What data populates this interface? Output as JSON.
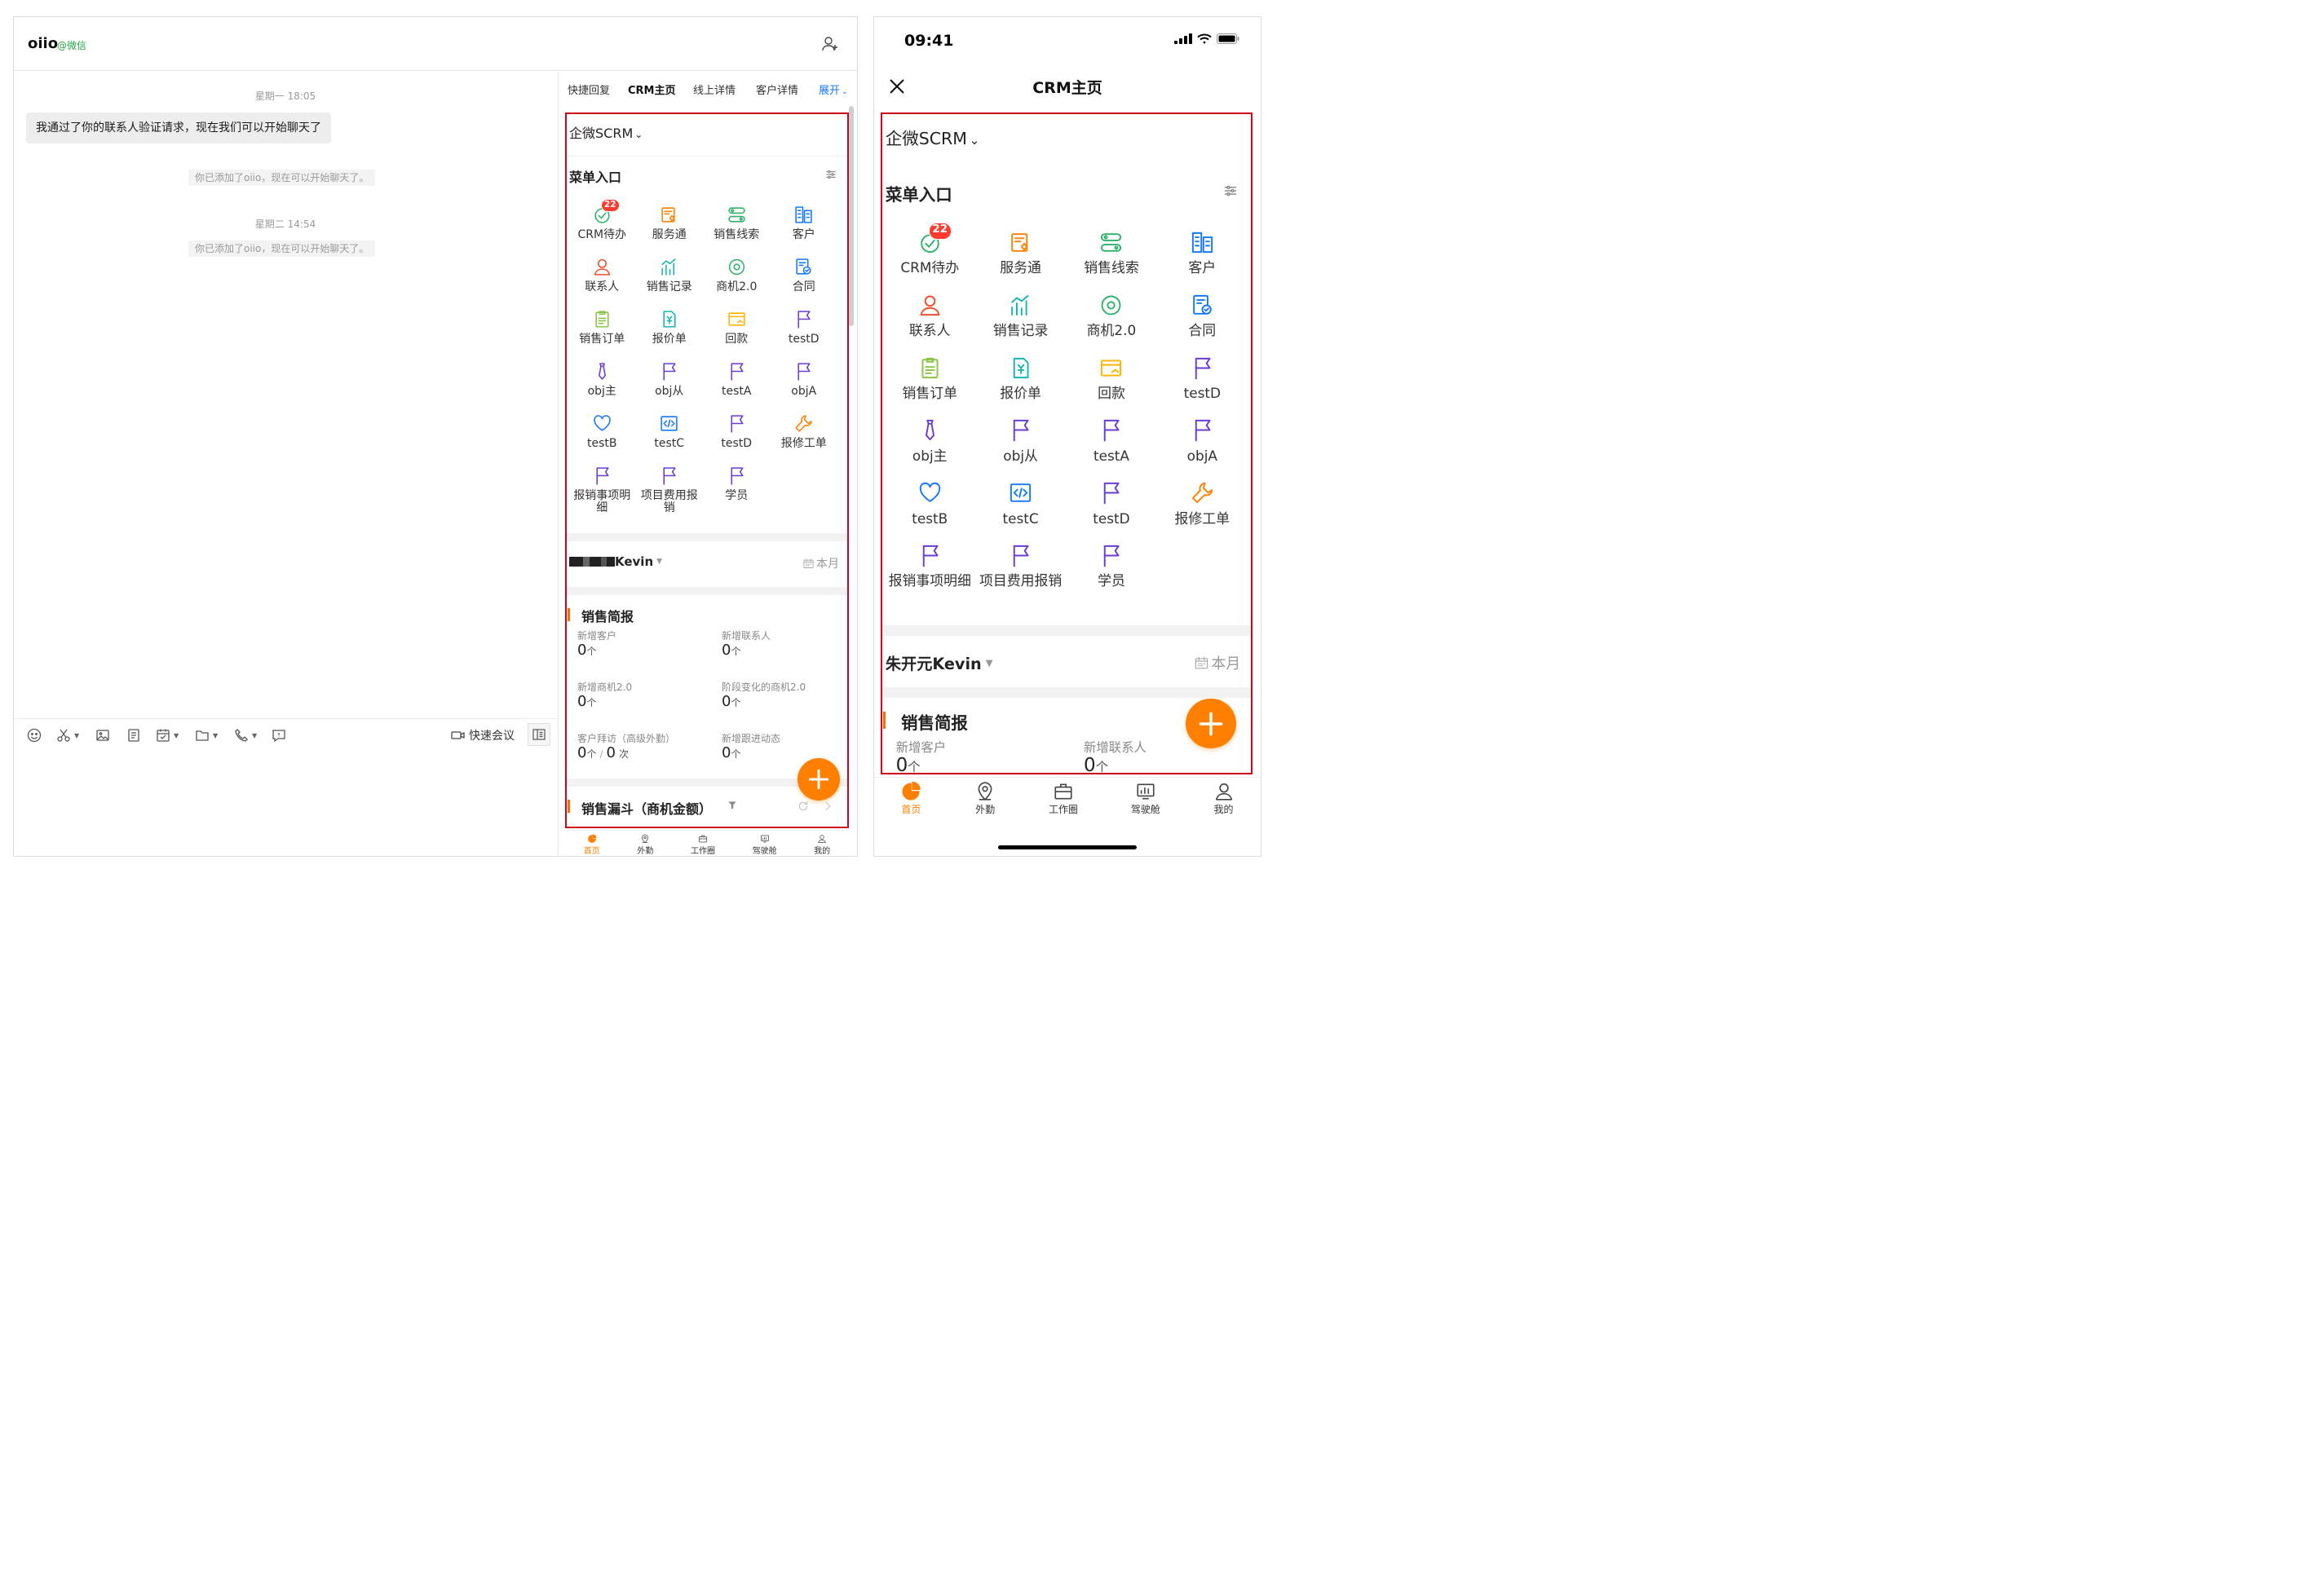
{
  "desktop": {
    "contact_name": "oiio",
    "contact_tag": "@微信",
    "chat": {
      "time_1": "星期一 18:05",
      "message": "我通过了你的联系人验证请求，现在我们可以开始聊天了",
      "system_note_1": "你已添加了oiio，现在可以开始聊天了。",
      "time_2": "星期二 14:54",
      "system_note_2": "你已添加了oiio，现在可以开始聊天了。"
    },
    "toolbar": {
      "quick_meeting": "快速会议",
      "icons": [
        "emoji-icon",
        "scissors-icon",
        "image-icon",
        "document-icon",
        "schedule-icon",
        "folder-icon",
        "phone-icon",
        "feedback-icon",
        "video-icon",
        "side-panel-icon"
      ]
    },
    "panel_tabs": [
      {
        "label": "快捷回复"
      },
      {
        "label": "CRM主页"
      },
      {
        "label": "线上详情"
      },
      {
        "label": "客户详情"
      },
      {
        "label": "展开"
      }
    ]
  },
  "crm": {
    "org_name": "企微SCRM",
    "menu_title": "菜单入口",
    "menu_items": [
      {
        "label": "CRM待办",
        "icon": "todo-icon",
        "color": "#2fb36b",
        "badge": "22"
      },
      {
        "label": "服务通",
        "icon": "service-icon",
        "color": "#ff7f00"
      },
      {
        "label": "销售线索",
        "icon": "leads-icon",
        "color": "#2fb36b"
      },
      {
        "label": "客户",
        "icon": "customer-icon",
        "color": "#1677ff"
      },
      {
        "label": "联系人",
        "icon": "contact-icon",
        "color": "#f04d2e"
      },
      {
        "label": "销售记录",
        "icon": "sales-record-icon",
        "color": "#17b4b4"
      },
      {
        "label": "商机2.0",
        "icon": "opportunity-icon",
        "color": "#2fb36b"
      },
      {
        "label": "合同",
        "icon": "contract-icon",
        "color": "#1677ff"
      },
      {
        "label": "销售订单",
        "icon": "sales-order-icon",
        "color": "#8bc34a"
      },
      {
        "label": "报价单",
        "icon": "quote-icon",
        "color": "#17b4b4"
      },
      {
        "label": "回款",
        "icon": "payment-icon",
        "color": "#ffb300"
      },
      {
        "label": "testD",
        "icon": "flag-icon",
        "color": "#6b3bd6"
      },
      {
        "label": "obj主",
        "icon": "tie-icon",
        "color": "#6b3bd6"
      },
      {
        "label": "obj从",
        "icon": "flag-icon",
        "color": "#6b3bd6"
      },
      {
        "label": "testA",
        "icon": "flag-icon",
        "color": "#6b3bd6"
      },
      {
        "label": "objA",
        "icon": "flag-icon",
        "color": "#6b3bd6"
      },
      {
        "label": "testB",
        "icon": "heart-icon",
        "color": "#1677ff"
      },
      {
        "label": "testC",
        "icon": "code-icon",
        "color": "#1677ff"
      },
      {
        "label": "testD",
        "icon": "flag-icon",
        "color": "#6b3bd6"
      },
      {
        "label": "报修工单",
        "icon": "wrench-icon",
        "color": "#ff7f00"
      },
      {
        "label": "报销事项明细",
        "icon": "flag-icon",
        "color": "#6b3bd6"
      },
      {
        "label": "项目费用报销",
        "icon": "flag-icon",
        "color": "#6b3bd6"
      },
      {
        "label": "学员",
        "icon": "flag-icon",
        "color": "#6b3bd6"
      }
    ],
    "user_name_desktop": "Kevin",
    "user_name_phone": "朱开元Kevin",
    "period": "本月",
    "sales_brief": {
      "title": "销售简报",
      "stats": [
        {
          "label": "新增客户",
          "value": "0",
          "unit": "个"
        },
        {
          "label": "新增联系人",
          "value": "0",
          "unit": "个"
        },
        {
          "label": "新增商机2.0",
          "value": "0",
          "unit": "个"
        },
        {
          "label": "阶段变化的商机2.0",
          "value": "0",
          "unit": "个"
        },
        {
          "label": "客户拜访（高级外勤）",
          "value": "0",
          "unit": "个",
          "value2": "0",
          "unit2": "次"
        },
        {
          "label": "新增跟进动态",
          "value": "0",
          "unit": "个"
        }
      ]
    },
    "funnel_title": "销售漏斗（商机金额）",
    "bottom_nav": [
      {
        "label": "首页",
        "icon": "home-pie-icon",
        "active": true
      },
      {
        "label": "外勤",
        "icon": "location-icon",
        "active": false
      },
      {
        "label": "工作圈",
        "icon": "briefcase-icon",
        "active": false
      },
      {
        "label": "驾驶舱",
        "icon": "dashboard-icon",
        "active": false
      },
      {
        "label": "我的",
        "icon": "profile-icon",
        "active": false
      }
    ],
    "accent_color": "#ff7f00",
    "highlight_border_color": "#d0021b"
  },
  "phone": {
    "time": "09:41",
    "title": "CRM主页"
  }
}
